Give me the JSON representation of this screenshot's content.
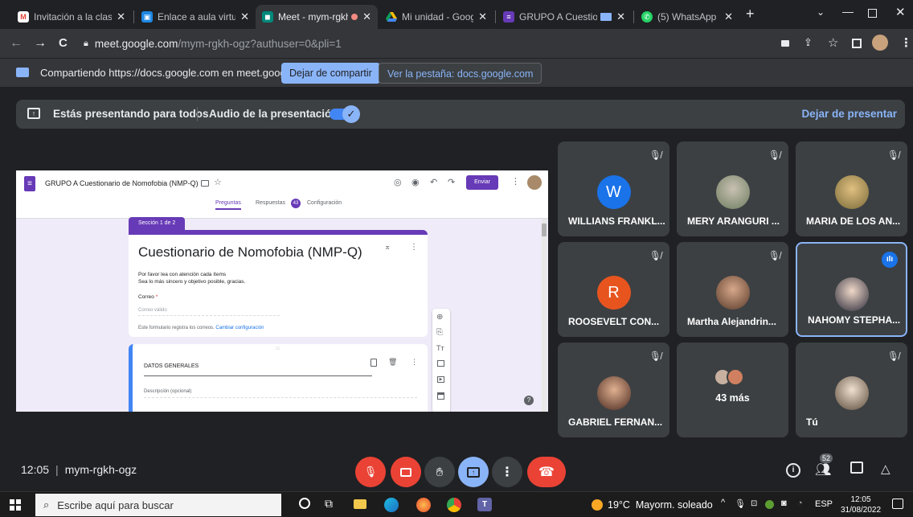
{
  "browser": {
    "tabs": [
      {
        "title": "Invitación a la clase: \"",
        "favicon": "gmail-icon",
        "active": false
      },
      {
        "title": "Enlace a aula virtual",
        "favicon": "classroom-icon",
        "active": false
      },
      {
        "title": "Meet - mym-rgkh",
        "favicon": "meet-icon",
        "active": true
      },
      {
        "title": "Mi unidad - Google D",
        "favicon": "drive-icon",
        "active": false
      },
      {
        "title": "GRUPO A Cuestio",
        "favicon": "forms-icon",
        "active": false
      },
      {
        "title": "(5) WhatsApp",
        "favicon": "whatsapp-icon",
        "active": false
      }
    ],
    "url_domain": "meet.google.com",
    "url_path": "/mym-rgkh-ogz?authuser=0&pli=1"
  },
  "sharebar": {
    "text": "Compartiendo https://docs.google.com en meet.google.com",
    "stop_label": "Dejar de compartir",
    "view_tab_label": "Ver la pestaña: docs.google.com"
  },
  "presenting": {
    "text": "Estás presentando para todos",
    "audio_label": "Audio de la presentación",
    "stop_label": "Dejar de presentar"
  },
  "doc": {
    "title": "GRUPO A Cuestionario de Nomofobia (NMP-Q)",
    "send_label": "Enviar",
    "tabs": [
      "Preguntas",
      "Respuestas",
      "Configuración"
    ],
    "responses_count": "43",
    "section_label": "Sección 1 de 2",
    "form_title": "Cuestionario de Nomofobia (NMP-Q)",
    "desc_line1": "Por favor lea con atención cada ítems",
    "desc_line2": "Sea lo más sincero y objetivo posible, gracias.",
    "email_label": "Correo",
    "email_placeholder": "Correo válido",
    "email_note": "Este formulario registra los correos.",
    "email_link": "Cambiar configuración",
    "section2_title": "DATOS GENERALES",
    "section2_desc": "Descripción (opcional)"
  },
  "participants": [
    {
      "name": "WILLIANS FRANKL...",
      "initial": "W",
      "color": "#1a73e8",
      "type": "initial"
    },
    {
      "name": "MERY ARANGURI ...",
      "type": "photo",
      "color": "#8a9a7a"
    },
    {
      "name": "MARIA DE LOS AN...",
      "type": "photo",
      "color": "#a08a5a"
    },
    {
      "name": "ROOSEVELT CON...",
      "initial": "R",
      "color": "#e8541e",
      "type": "initial"
    },
    {
      "name": "Martha Alejandrin...",
      "type": "photo",
      "color": "#9a7060"
    },
    {
      "name": "NAHOMY STEPHA...",
      "type": "photo",
      "color": "#5a6a7a",
      "speaking": true
    },
    {
      "name": "GABRIEL FERNAN...",
      "type": "photo",
      "color": "#a06a50"
    },
    {
      "name": "43 más",
      "type": "more"
    },
    {
      "name": "Tú",
      "type": "photo",
      "color": "#7a7060"
    }
  ],
  "meeting": {
    "time": "12:05",
    "code": "mym-rgkh-ogz",
    "people_count": "52"
  },
  "taskbar": {
    "search_placeholder": "Escribe aquí para buscar",
    "weather": "19°C  Mayorm. soleado",
    "lang": "ESP",
    "clock_time": "12:05",
    "clock_date": "31/08/2022"
  },
  "colors": {
    "meet_bg": "#202124",
    "tile_bg": "#3c4043",
    "accent_blue": "#8ab4f8",
    "end_call_red": "#ea4335",
    "forms_purple": "#673ab7"
  }
}
